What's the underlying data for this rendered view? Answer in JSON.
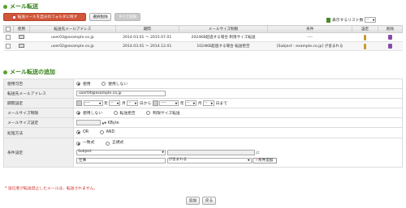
{
  "forward_section": {
    "title": "メール転送",
    "buttons": {
      "keep_copy": "転送メールを自分のフォルダに残す",
      "move": "選択削除",
      "delete_all": "すべて削除"
    },
    "per_page_label": "表示するリスト数",
    "per_page_value": "--",
    "table": {
      "headers": [
        "",
        "使用",
        "転送先メールアドレス",
        "期間",
        "メールサイズ制限",
        "条件",
        "設定",
        "削除"
      ],
      "rows": [
        {
          "email": "user03@example.co.jp",
          "period": "2014.03.01 ～ 2015.07.01",
          "size_limit": "2024KB超過する場合 制限サイズ転送",
          "condition": "----"
        },
        {
          "email": "user02@example.co.jp",
          "period": "2014.03.01 ～ 2014.12.01",
          "size_limit": "1024KB超過する場合 転送拒否",
          "condition": "[Subject : example.co.jp] が含まれる"
        }
      ]
    }
  },
  "add_section": {
    "title": "メール転送の追加",
    "rows": {
      "enable": {
        "label": "使用可否",
        "opt_on": "使用",
        "opt_off": "使用しない"
      },
      "address": {
        "label": "転送先メールアドレス",
        "value": "user04@example.co.jp"
      },
      "period": {
        "label": "期間設定",
        "dash": "----",
        "year": "年",
        "month_dash": "--",
        "month": "月",
        "day": "日から",
        "day_end": "日まで"
      },
      "size": {
        "label": "メールサイズ制限",
        "opt1": "使用しない",
        "opt2": "転送拒否",
        "opt3": "制限サイズ転送"
      },
      "size_setting": {
        "label": "メールサイズ設定",
        "unit": "KByte"
      },
      "method": {
        "label": "処理方法",
        "opt_or": "OR",
        "opt_and": "AND"
      },
      "condition": {
        "label": "条件設定",
        "opt_match": "一致式",
        "opt_regex": "正規式",
        "field1": "Subject",
        "ni": "に",
        "field2": "仕事",
        "contains": "が含まれる",
        "add_button": "条件追加"
      }
    },
    "warning": "* 送信者が転送禁止したメールは、転送されません。",
    "buttons": {
      "add": "追加",
      "back": "戻る"
    }
  }
}
